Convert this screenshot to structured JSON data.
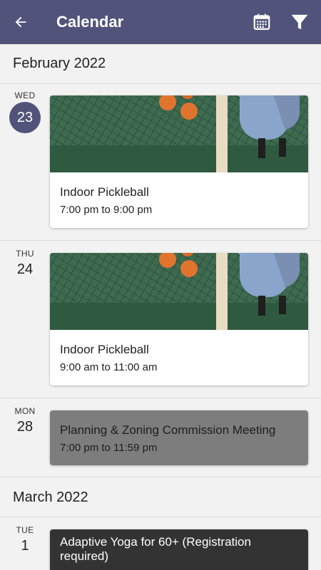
{
  "header": {
    "title": "Calendar",
    "background": "#51537a"
  },
  "months": [
    {
      "label": "February 2022",
      "days": [
        {
          "dow": "WED",
          "num": "23",
          "today": true,
          "events": [
            {
              "title": "Indoor Pickleball",
              "time": "7:00 pm to 9:00 pm",
              "image": "pickleball-image"
            }
          ]
        },
        {
          "dow": "THU",
          "num": "24",
          "events": [
            {
              "title": "Indoor Pickleball",
              "time": "9:00 am to 11:00 am",
              "image": "pickleball-image"
            }
          ]
        },
        {
          "dow": "MON",
          "num": "28",
          "events": [
            {
              "title": "Planning & Zoning Commission Meeting",
              "time": "7:00 pm to 11:59 pm",
              "color": "#7d7d7d"
            }
          ]
        }
      ]
    },
    {
      "label": "March 2022",
      "days": [
        {
          "dow": "TUE",
          "num": "1",
          "events": [
            {
              "title": "Adaptive Yoga for 60+ (Registration required)",
              "color": "#333333"
            }
          ]
        }
      ]
    }
  ]
}
